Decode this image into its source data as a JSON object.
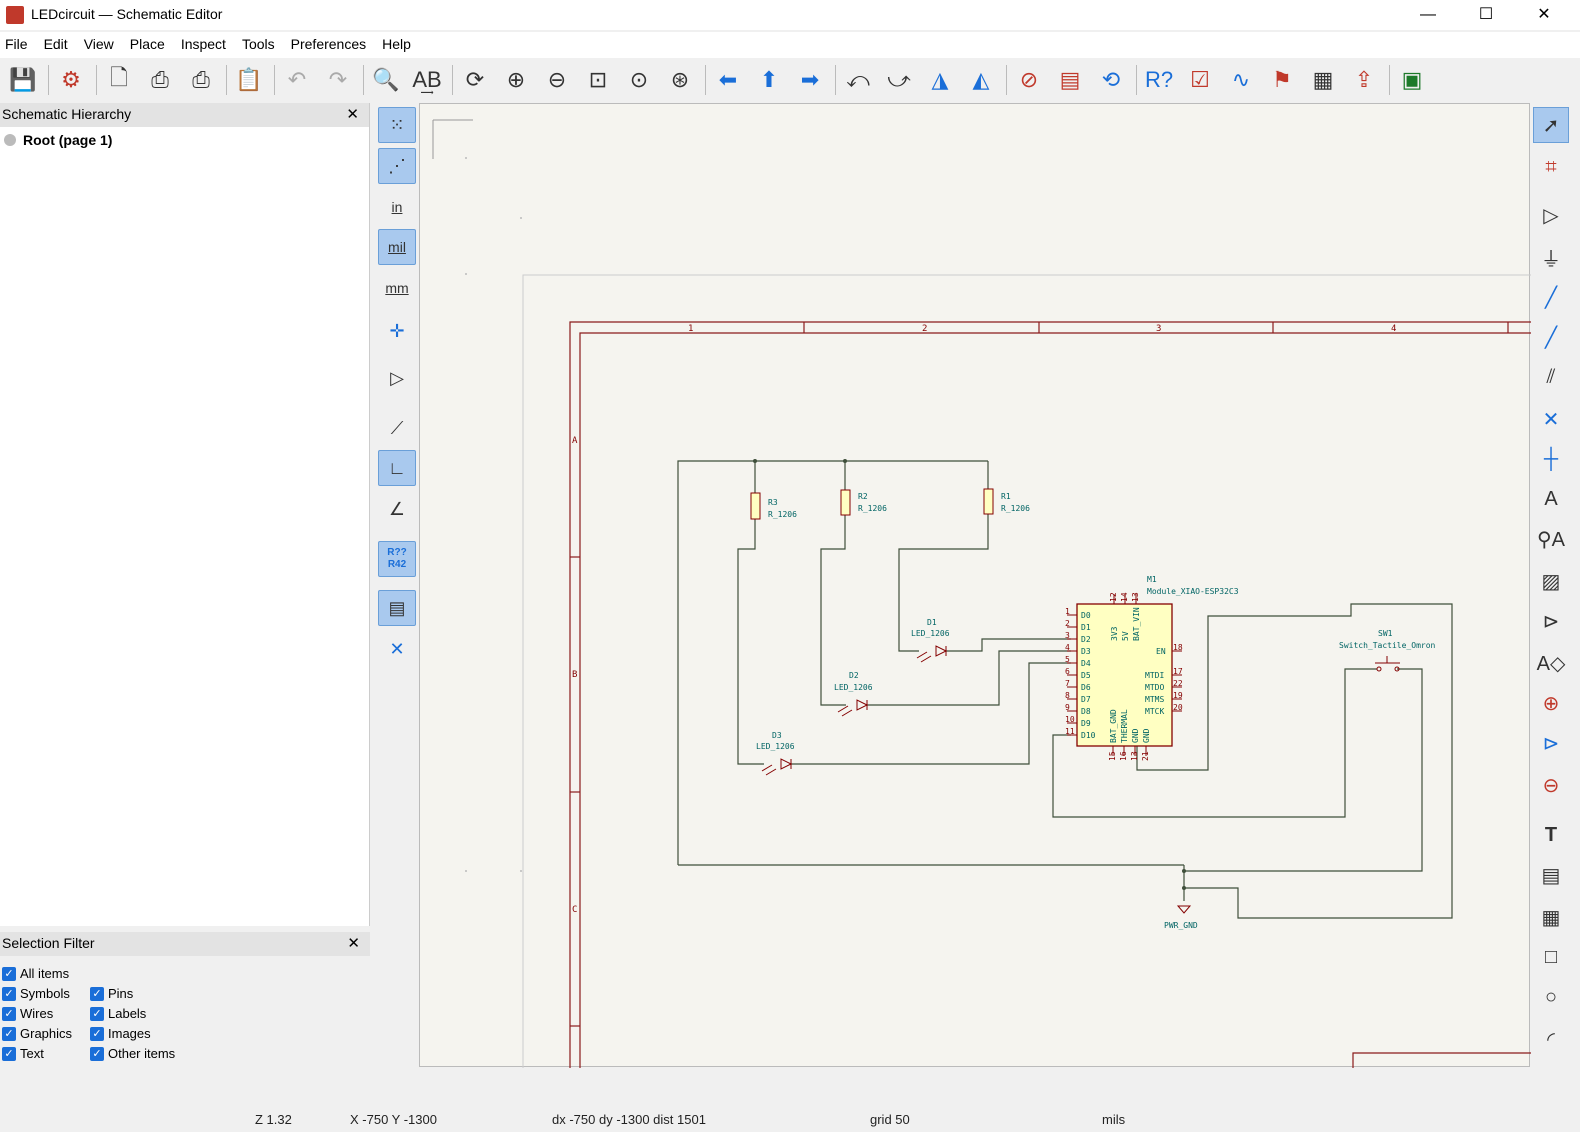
{
  "window": {
    "title": "LEDcircuit — Schematic Editor",
    "minimize": "—",
    "maximize": "☐",
    "close": "✕"
  },
  "menu": [
    "File",
    "Edit",
    "View",
    "Place",
    "Inspect",
    "Tools",
    "Preferences",
    "Help"
  ],
  "hierarchy": {
    "title": "Schematic Hierarchy",
    "root": "Root (page 1)",
    "close": "✕"
  },
  "selection_filter": {
    "title": "Selection Filter",
    "close": "✕",
    "items": [
      {
        "label": "All items",
        "checked": true
      },
      {
        "label": "Symbols",
        "checked": true
      },
      {
        "label": "Pins",
        "checked": true
      },
      {
        "label": "Wires",
        "checked": true
      },
      {
        "label": "Labels",
        "checked": true
      },
      {
        "label": "Graphics",
        "checked": true
      },
      {
        "label": "Images",
        "checked": true
      },
      {
        "label": "Text",
        "checked": true
      },
      {
        "label": "Other items",
        "checked": true
      }
    ]
  },
  "left_toolbar": {
    "units_in": "in",
    "units_mil": "mil",
    "units_mm": "mm",
    "annotate": "R??\nR42"
  },
  "schematic": {
    "columns": [
      "1",
      "2",
      "3",
      "4"
    ],
    "rows": [
      "A",
      "B",
      "C"
    ],
    "R3": {
      "ref": "R3",
      "value": "R_1206"
    },
    "R2": {
      "ref": "R2",
      "value": "R_1206"
    },
    "R1": {
      "ref": "R1",
      "value": "R_1206"
    },
    "D1": {
      "ref": "D1",
      "value": "LED_1206"
    },
    "D2": {
      "ref": "D2",
      "value": "LED_1206"
    },
    "D3": {
      "ref": "D3",
      "value": "LED_1206"
    },
    "U1": {
      "ref": "M1",
      "value": "Module_XIAO-ESP32C3",
      "left_pins": [
        "D0",
        "D1",
        "D2",
        "D3",
        "D4",
        "D5",
        "D6",
        "D7",
        "D8",
        "D9",
        "D10"
      ],
      "left_nums": [
        "1",
        "2",
        "3",
        "4",
        "5",
        "6",
        "7",
        "8",
        "9",
        "10",
        "11"
      ],
      "top_pins": [
        "3V3",
        "5V",
        "BAT_VIN"
      ],
      "top_nums": [
        "12",
        "14",
        "13"
      ],
      "right_pins": [
        "EN",
        "MTDI",
        "MTDO",
        "MTMS",
        "MTCK"
      ],
      "right_nums": [
        "18",
        "17",
        "22",
        "19",
        "20"
      ],
      "bottom_pins": [
        "BAT_GND",
        "THERMAL",
        "GND",
        "GND"
      ],
      "bottom_nums": [
        "15",
        "16",
        "13",
        "21"
      ]
    },
    "SW1": {
      "ref": "SW1",
      "value": "Switch_Tactile_Omron"
    },
    "gnd": {
      "label": "PWR_GND"
    }
  },
  "status": {
    "zoom": "Z 1.32",
    "xy": "X -750  Y -1300",
    "delta": "dx -750  dy -1300  dist 1501",
    "grid": "grid 50",
    "units": "mils"
  }
}
